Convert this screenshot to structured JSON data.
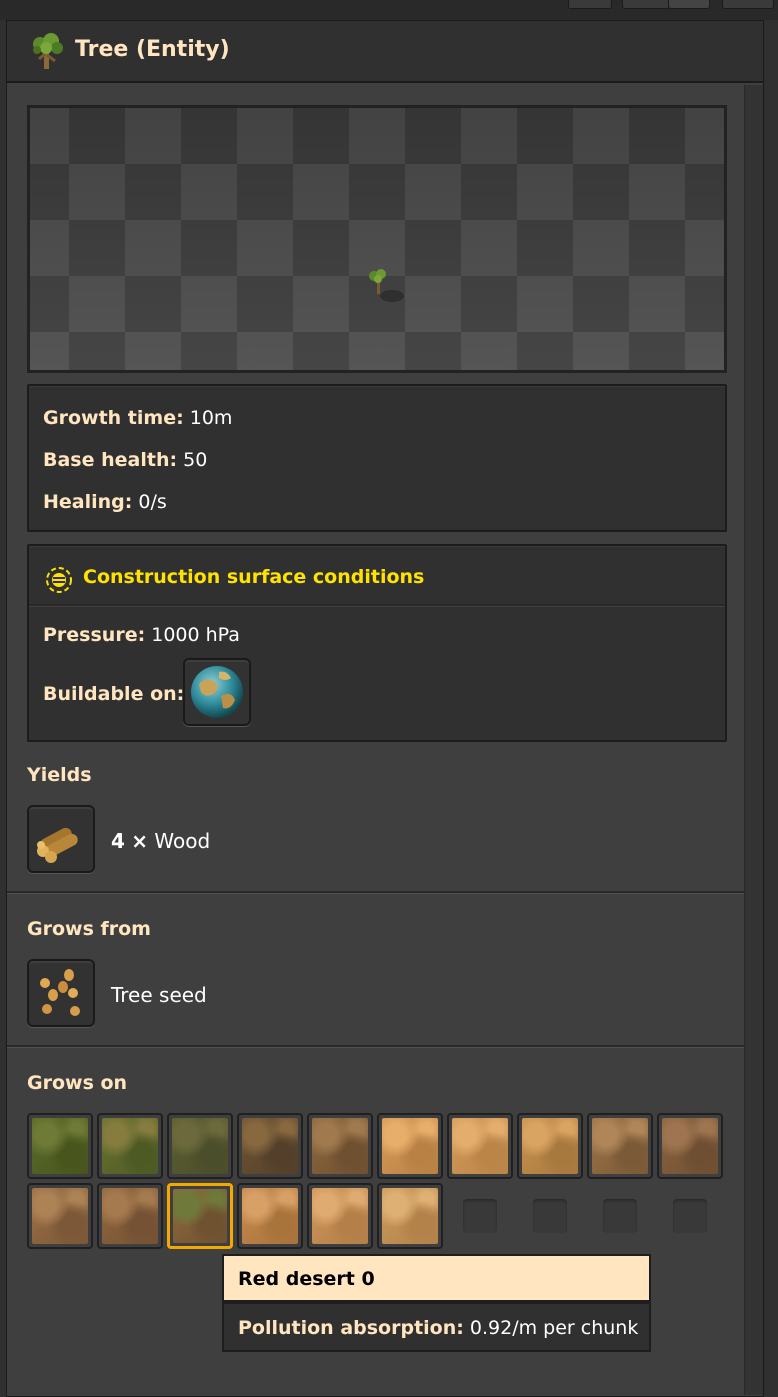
{
  "window": {
    "title": "Tree (Entity)"
  },
  "stats": {
    "growth_label": "Growth time:",
    "growth_value": "10m",
    "health_label": "Base health:",
    "health_value": "50",
    "healing_label": "Healing:",
    "healing_value": "0/s"
  },
  "conditions": {
    "title": "Construction surface conditions",
    "pressure_label": "Pressure:",
    "pressure_value": "1000 hPa",
    "buildable_label": "Buildable on:"
  },
  "yields": {
    "heading": "Yields",
    "count": "4",
    "times": "×",
    "item": "Wood"
  },
  "grows_from": {
    "heading": "Grows from",
    "item": "Tree seed"
  },
  "grows_on": {
    "heading": "Grows on",
    "tiles": [
      {
        "name": "grass-tile-1",
        "colors": [
          "#5a6a2a",
          "#48561e",
          "#6e7a35"
        ]
      },
      {
        "name": "grass-tile-2",
        "colors": [
          "#6a7232",
          "#4e5a24",
          "#857c3e"
        ]
      },
      {
        "name": "grass-tile-3",
        "colors": [
          "#5b5f31",
          "#4b4e2a",
          "#6c6a3c"
        ]
      },
      {
        "name": "dirt-tile-1",
        "colors": [
          "#6e5535",
          "#54402a",
          "#87683f"
        ]
      },
      {
        "name": "dirt-tile-2",
        "colors": [
          "#8d6840",
          "#6f5030",
          "#a07a4e"
        ]
      },
      {
        "name": "sand-tile-1",
        "colors": [
          "#d59a58",
          "#b98144",
          "#e6ad6b"
        ]
      },
      {
        "name": "sand-tile-2",
        "colors": [
          "#d39a5a",
          "#bb8548",
          "#e4ad6e"
        ]
      },
      {
        "name": "sand-tile-3",
        "colors": [
          "#c89250",
          "#a8793e",
          "#d9a462"
        ]
      },
      {
        "name": "desert-tile-1",
        "colors": [
          "#9c7448",
          "#7b5a37",
          "#b08658"
        ]
      },
      {
        "name": "desert-tile-2",
        "colors": [
          "#8a6440",
          "#6f4f32",
          "#9e7550"
        ]
      },
      {
        "name": "dirt-tile-3",
        "colors": [
          "#9a7046",
          "#7c5838",
          "#ad8255"
        ]
      },
      {
        "name": "dirt-tile-4",
        "colors": [
          "#91683f",
          "#755234",
          "#a67a4f"
        ]
      },
      {
        "name": "red-desert-tile",
        "colors": [
          "#8e6a3f",
          "#6f5230",
          "#6f7a3a"
        ]
      },
      {
        "name": "sand-tile-4",
        "colors": [
          "#c68a4c",
          "#a9733c",
          "#d8a066"
        ]
      },
      {
        "name": "sand-tile-5",
        "colors": [
          "#cf955a",
          "#b47f48",
          "#e0ab70"
        ]
      },
      {
        "name": "sand-tile-6",
        "colors": [
          "#cd9a5d",
          "#b2824a",
          "#dfb073"
        ]
      }
    ],
    "selected_index": 12,
    "empty_slots": 4
  },
  "tooltip": {
    "title": "Red desert 0",
    "label": "Pollution absorption:",
    "value": "0.92/m per chunk"
  },
  "colors": {
    "accent_yellow": "#ffe300",
    "label_cream": "#ffe6c0",
    "selection_orange": "#f5a800"
  }
}
